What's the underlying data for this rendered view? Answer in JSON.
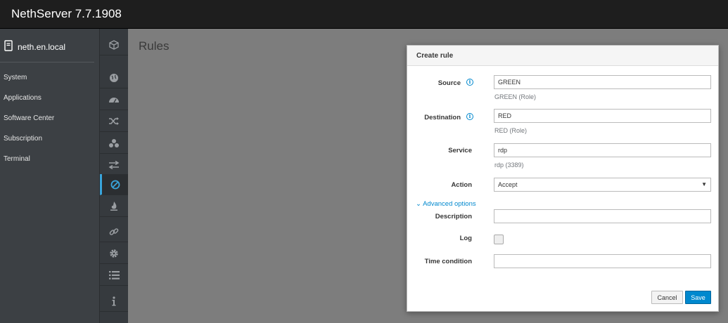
{
  "app": {
    "title": "NethServer 7.7.1908"
  },
  "sidebar": {
    "host": "neth.en.local",
    "items": [
      {
        "label": "System"
      },
      {
        "label": "Applications"
      },
      {
        "label": "Software Center"
      },
      {
        "label": "Subscription"
      },
      {
        "label": "Terminal"
      }
    ]
  },
  "icon_bar": {
    "icons": [
      "cube-icon",
      "globe-icon",
      "dashboard-icon",
      "shuffle-icon",
      "network-icon",
      "arrows-icon",
      "ban-icon",
      "fire-icon",
      "link-icon",
      "gear-icon",
      "list-icon",
      "info-icon"
    ],
    "active": "ban-icon"
  },
  "page": {
    "title": "Rules"
  },
  "modal": {
    "title": "Create rule",
    "source": {
      "label": "Source",
      "value": "GREEN",
      "help": "GREEN (Role)"
    },
    "destination": {
      "label": "Destination",
      "value": "RED",
      "help": "RED (Role)"
    },
    "service": {
      "label": "Service",
      "value": "rdp",
      "help": "rdp (3389)"
    },
    "action": {
      "label": "Action",
      "value": "Accept"
    },
    "advanced_label": "Advanced options",
    "description": {
      "label": "Description",
      "value": ""
    },
    "log": {
      "label": "Log",
      "checked": false
    },
    "time_condition": {
      "label": "Time condition",
      "value": ""
    },
    "cancel_label": "Cancel",
    "save_label": "Save"
  },
  "colors": {
    "accent": "#0088ce",
    "active_indicator": "#39a5dc",
    "topbar": "#1e1e1e",
    "sidebar": "#3c4044"
  }
}
